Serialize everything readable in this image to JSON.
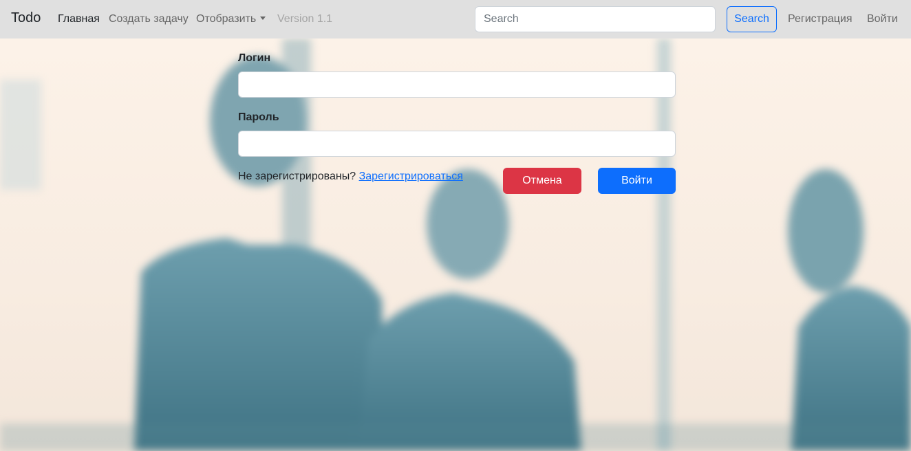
{
  "navbar": {
    "brand": "Todo",
    "links": [
      {
        "label": "Главная"
      },
      {
        "label": "Создать задачу"
      },
      {
        "label": "Отобразить"
      },
      {
        "label": "Version 1.1"
      }
    ],
    "search": {
      "placeholder": "Search",
      "button_label": "Search"
    },
    "register_label": "Регистрация",
    "login_label": "Войти"
  },
  "form": {
    "login_label": "Логин",
    "login_value": "",
    "password_label": "Пароль",
    "password_value": "",
    "not_registered_text": "Не зарегистрированы?",
    "register_link": "Зарегистрироваться",
    "cancel_label": "Отмена",
    "submit_label": "Войти"
  },
  "colors": {
    "navbar_bg": "#e0e0e0",
    "primary": "#0d6efd",
    "danger": "#dc3545"
  }
}
